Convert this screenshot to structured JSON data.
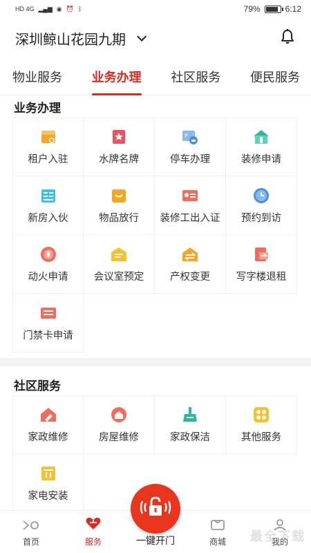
{
  "status_bar": {
    "left_text": "HD 4G",
    "battery": "79%",
    "battery_level": 0.79,
    "time": "6:12"
  },
  "header": {
    "community": "深圳鲸山花园九期"
  },
  "tabs": [
    {
      "label": "物业服务",
      "active": false
    },
    {
      "label": "业务办理",
      "active": true
    },
    {
      "label": "社区服务",
      "active": false
    },
    {
      "label": "便民服务",
      "active": false
    }
  ],
  "business": {
    "title": "业务办理",
    "items": [
      {
        "label": "租户入驻",
        "icon": "tenant-icon",
        "color": "#f6a623"
      },
      {
        "label": "水牌名牌",
        "icon": "nameplate-icon",
        "color": "#f1515e"
      },
      {
        "label": "停车办理",
        "icon": "parking-icon",
        "color": "#4a90e2"
      },
      {
        "label": "装修申请",
        "icon": "renovation-icon",
        "color": "#2cb99a"
      },
      {
        "label": "新房入伙",
        "icon": "move-in-icon",
        "color": "#3ec1e6"
      },
      {
        "label": "物品放行",
        "icon": "goods-pass-icon",
        "color": "#f6a623"
      },
      {
        "label": "装修工出入证",
        "icon": "worker-pass-icon",
        "color": "#f26b5b"
      },
      {
        "label": "预约到访",
        "icon": "visit-clock-icon",
        "color": "#4a90e2"
      },
      {
        "label": "动火申请",
        "icon": "fire-icon",
        "color": "#f26b5b"
      },
      {
        "label": "会议室预定",
        "icon": "meeting-room-icon",
        "color": "#f6c12d"
      },
      {
        "label": "产权变更",
        "icon": "property-change-icon",
        "color": "#f6a623"
      },
      {
        "label": "写字楼退租",
        "icon": "office-checkout-icon",
        "color": "#f26b5b"
      },
      {
        "label": "门禁卡申请",
        "icon": "access-card-icon",
        "color": "#f26b5b"
      }
    ]
  },
  "community": {
    "title": "社区服务",
    "items": [
      {
        "label": "家政维修",
        "icon": "home-repair-icon",
        "color": "#f26b5b"
      },
      {
        "label": "房屋维修",
        "icon": "house-repair-icon",
        "color": "#f26b5b"
      },
      {
        "label": "家政保洁",
        "icon": "cleaning-icon",
        "color": "#2cb99a"
      },
      {
        "label": "其他服务",
        "icon": "other-services-icon",
        "color": "#f6c12d"
      },
      {
        "label": "家电安装",
        "icon": "appliance-install-icon",
        "color": "#f6c12d"
      }
    ]
  },
  "bottom_nav": {
    "home": "首页",
    "service": "服务",
    "one_key_open": "一键开门",
    "mall": "商城",
    "mine": "我的"
  },
  "watermark": "最全下载",
  "colors": {
    "accent": "#e0281c",
    "fab": "#e8351c"
  }
}
